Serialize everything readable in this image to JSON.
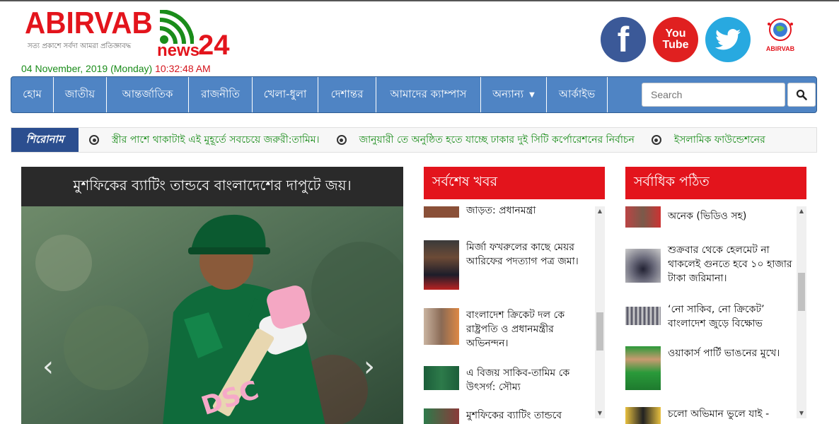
{
  "header": {
    "logo_main": "ABIRVAB",
    "logo_tagline": "সত্য প্রকাশে সর্বদা আমরা প্রতিজ্ঞাবদ্ধ",
    "logo_news": "news",
    "logo_number": "24",
    "date": "04 November, 2019 (Monday)",
    "time": "10:32:48 AM",
    "social": [
      {
        "name": "facebook",
        "icon": "facebook-icon",
        "glyph": "f",
        "color": "#3b5998"
      },
      {
        "name": "youtube",
        "icon": "youtube-icon",
        "line1": "You",
        "line2": "Tube",
        "color": "#e02020"
      },
      {
        "name": "twitter",
        "icon": "twitter-icon",
        "color": "#28a9e0"
      }
    ],
    "foundation_label": "ABIRVAB"
  },
  "nav": {
    "items": [
      "হোম",
      "জাতীয়",
      "আন্তর্জাতিক",
      "রাজনীতি",
      "খেলা-ধুলা",
      "দেশান্তর",
      "আমাদের ক্যাম্পাস",
      "অন্যান্য",
      "আর্কাইভ"
    ],
    "search_placeholder": "Search"
  },
  "ticker": {
    "label": "শিরোনাম",
    "items": [
      "স্ত্রীর পাশে থাকাটাই এই মুহূর্তে সবচেয়ে জরুরী:তামিম।",
      "জানুয়ারী তে অনুষ্ঠিত হতে যাচ্ছে ঢাকার দুই সিটি কর্পোরেশনের নির্বাচন",
      "ইসলামিক ফাউন্ডেশনের"
    ]
  },
  "slider": {
    "title": "মুশফিকের ব্যাটিং তান্ডবে বাংলাদেশের দাপুটে জয়।",
    "jersey_text": "DSC"
  },
  "latest": {
    "heading": "সর্বশেষ খবর",
    "items": [
      "জড়িত: প্রধানমন্ত্রী",
      "মির্জা ফখরুলের কাছে মেয়র আরিফের পদত্যাগ পত্র জমা।",
      "বাংলাদেশ ক্রিকেট দল কে রাষ্ট্রপতি ও প্রধানমন্ত্রীর অভিনন্দন।",
      "এ বিজয় সাকিব-তামিম কে উৎসর্গ: সৌম্য",
      "মুশফিকের ব্যাটিং তান্ডবে"
    ]
  },
  "popular": {
    "heading": "সর্বাধিক পঠিত",
    "items": [
      "অনেক (ভিডিও সহ)",
      "শুক্রবার থেকে হেলমেট না থাকলেই গুনতে হবে ১০ হাজার টাকা জরিমানা।",
      "‘নো সাকিব, নো ক্রিকেট’ বাংলাদেশ জুড়ে বিক্ষোভ",
      "ওয়াকার্স পার্টি ভাঙনের মুখে।",
      "চলো অভিমান ভুলে যাই -"
    ]
  }
}
